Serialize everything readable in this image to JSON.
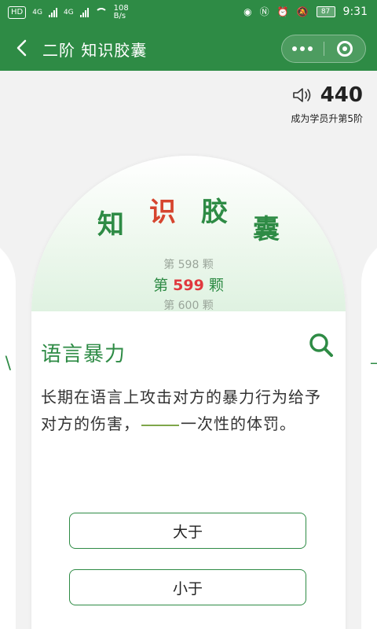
{
  "status_bar": {
    "hd": "HD",
    "net1": "4G",
    "net2": "4G",
    "speed_value": "108",
    "speed_unit": "B/s",
    "battery": "87",
    "time": "9:31"
  },
  "title_bar": {
    "title": "二阶 知识胶囊"
  },
  "header": {
    "score": "440",
    "subtitle": "成为学员升第5阶"
  },
  "card": {
    "logo": [
      "知",
      "识",
      "胶",
      "囊"
    ],
    "prev": "第 598 颗",
    "current_prefix": "第",
    "current_number": "599",
    "current_suffix": "颗",
    "next": "第 600 颗",
    "term": "语言暴力",
    "question_part1": "长期在语言上攻击对方的暴力行为给予对方的伤害，",
    "question_part2": "一次性的体罚。",
    "options": [
      "大于",
      "小于"
    ]
  },
  "side_cards": {
    "left_glyph": "\\",
    "right_glyph": "ㄱ"
  },
  "colors": {
    "primary": "#2e8b45",
    "accent_red": "#e0383e"
  }
}
